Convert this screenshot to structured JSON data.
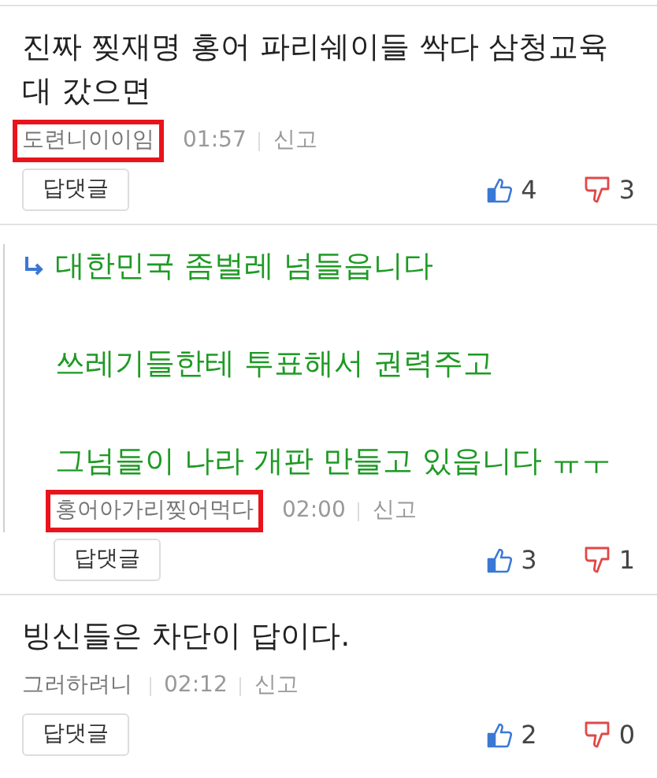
{
  "comments": [
    {
      "kind": "comment",
      "lines": [
        "진짜 찢재명 홍어 파리쉐이들 싹다 삼청교육대 갔으면"
      ],
      "author": "도련니이이임",
      "highlighted": true,
      "time": "01:57",
      "report": "신고",
      "reply_button": "답댓글",
      "likes": "4",
      "dislikes": "3"
    },
    {
      "kind": "reply",
      "lines": [
        "대한민국 좀벌레 넘들읍니다",
        "쓰레기들한테 투표해서 권력주고",
        "그넘들이 나라 개판 만들고 있읍니다 ㅠㅜ"
      ],
      "author": "홍어아가리찢어먹다",
      "highlighted": true,
      "time": "02:00",
      "report": "신고",
      "reply_button": "답댓글",
      "likes": "3",
      "dislikes": "1"
    },
    {
      "kind": "comment",
      "lines": [
        "빙신들은 차단이 답이다."
      ],
      "author": "그러하려니",
      "highlighted": false,
      "time": "02:12",
      "report": "신고",
      "reply_button": "답댓글",
      "likes": "2",
      "dislikes": "0"
    }
  ]
}
